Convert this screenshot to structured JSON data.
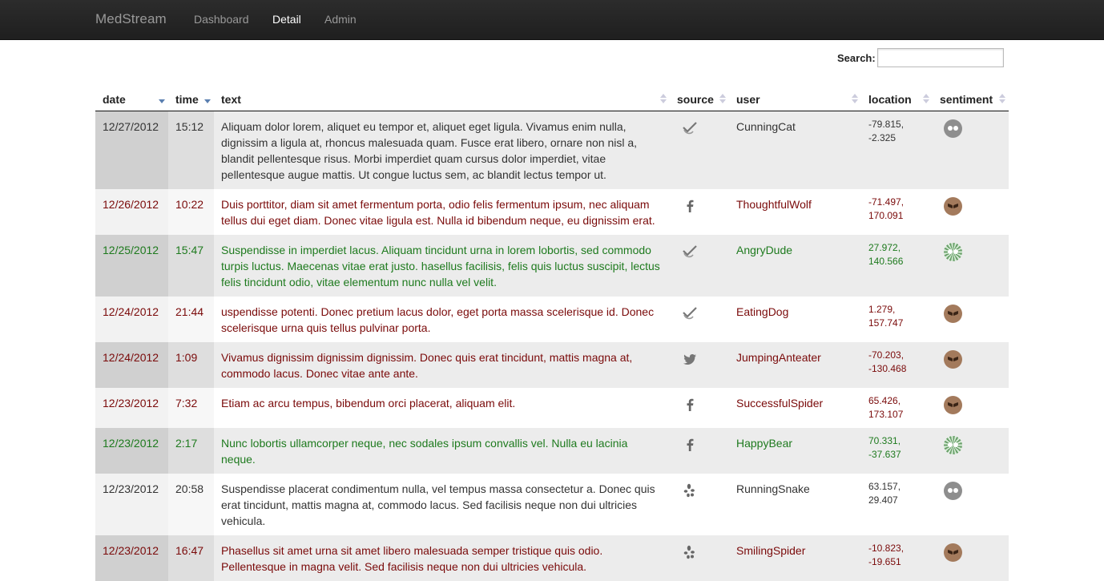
{
  "nav": {
    "brand": "MedStream",
    "links": [
      {
        "label": "Dashboard",
        "active": false
      },
      {
        "label": "Detail",
        "active": true
      },
      {
        "label": "Admin",
        "active": false
      }
    ]
  },
  "search": {
    "label": "Search:",
    "value": ""
  },
  "table": {
    "headers": [
      "date",
      "time",
      "text",
      "source",
      "user",
      "location",
      "sentiment"
    ],
    "rows": [
      {
        "date": "12/27/2012",
        "time": "15:12",
        "text": "Aliquam dolor lorem, aliquet eu tempor et, aliquet eget ligula. Vivamus enim nulla, dignissim a ligula at, rhoncus malesuada quam. Fusce erat libero, ornare non nisl a, blandit pellentesque risus. Morbi imperdiet quam cursus dolor imperdiet, vitae pellentesque augue mattis. Ut congue luctus sem, ac blandit lectus tempor ut.",
        "source": "checkmark-icon",
        "user": "CunningCat",
        "location": "-79.815, -2.325",
        "sentiment": "neutral"
      },
      {
        "date": "12/26/2012",
        "time": "10:22",
        "text": "Duis porttitor, diam sit amet fermentum porta, odio felis fermentum ipsum, nec aliquam tellus dui eget diam. Donec vitae ligula est. Nulla id bibendum neque, eu dignissim erat.",
        "source": "facebook-icon",
        "user": "ThoughtfulWolf",
        "location": "-71.497, 170.091",
        "sentiment": "negative"
      },
      {
        "date": "12/25/2012",
        "time": "15:47",
        "text": "Suspendisse in imperdiet lacus. Aliquam tincidunt urna in lorem lobortis, sed commodo turpis luctus. Maecenas vitae erat justo. hasellus facilisis, felis quis luctus suscipit, lectus felis tincidunt odio, vitae elementum nunc nulla vel velit.",
        "source": "checkmark-icon",
        "user": "AngryDude",
        "location": "27.972, 140.566",
        "sentiment": "positive"
      },
      {
        "date": "12/24/2012",
        "time": "21:44",
        "text": "uspendisse potenti. Donec pretium lacus dolor, eget porta massa scelerisque id. Donec scelerisque urna quis tellus pulvinar porta.",
        "source": "checkmark-icon",
        "user": "EatingDog",
        "location": "1.279, 157.747",
        "sentiment": "negative"
      },
      {
        "date": "12/24/2012",
        "time": "1:09",
        "text": "Vivamus dignissim dignissim dignissim. Donec quis erat tincidunt, mattis magna at, commodo lacus. Donec vitae ante ante.",
        "source": "twitter-icon",
        "user": "JumpingAnteater",
        "location": "-70.203, -130.468",
        "sentiment": "negative"
      },
      {
        "date": "12/23/2012",
        "time": "7:32",
        "text": "Etiam ac arcu tempus, bibendum orci placerat, aliquam elit.",
        "source": "facebook-icon",
        "user": "SuccessfulSpider",
        "location": "65.426, 173.107",
        "sentiment": "negative"
      },
      {
        "date": "12/23/2012",
        "time": "2:17",
        "text": "Nunc lobortis ullamcorper neque, nec sodales ipsum convallis vel. Nulla eu lacinia neque.",
        "source": "facebook-icon",
        "user": "HappyBear",
        "location": "70.331, -37.637",
        "sentiment": "positive"
      },
      {
        "date": "12/23/2012",
        "time": "20:58",
        "text": "Suspendisse placerat condimentum nulla, vel tempus massa consectetur a. Donec quis erat tincidunt, mattis magna at, commodo lacus. Sed facilisis neque non dui ultricies vehicula.",
        "source": "yelp-icon",
        "user": "RunningSnake",
        "location": "63.157, 29.407",
        "sentiment": "neutral"
      },
      {
        "date": "12/23/2012",
        "time": "16:47",
        "text": "Phasellus sit amet urna sit amet libero malesuada semper tristique quis odio. Pellentesque in magna velit. Sed facilisis neque non dui ultricies vehicula.",
        "source": "yelp-icon",
        "user": "SmilingSpider",
        "location": "-10.823, -19.651",
        "sentiment": "negative"
      }
    ]
  },
  "colors": {
    "neutral": "#333333",
    "negative": "#7a0a0a",
    "positive": "#1e7a1e"
  }
}
